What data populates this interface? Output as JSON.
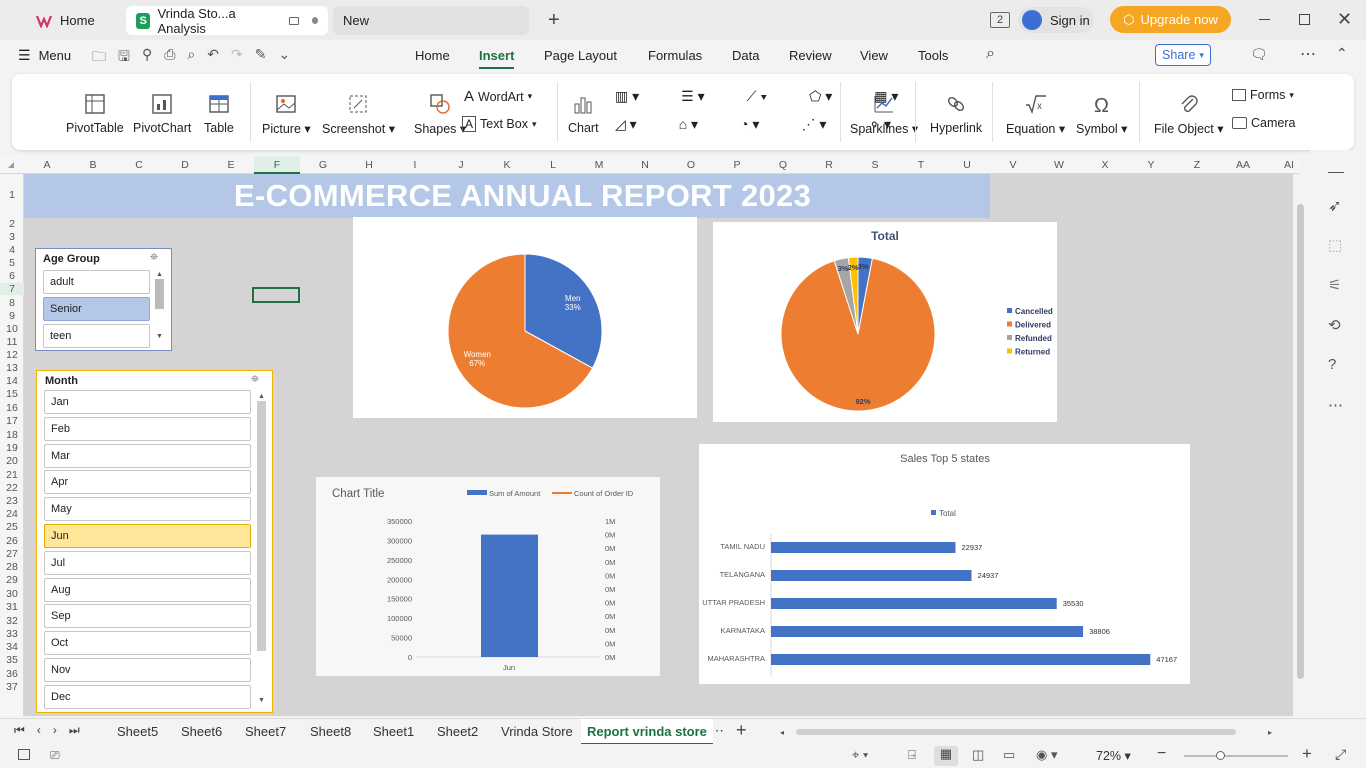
{
  "window": {
    "tabs": [
      {
        "label": "Home"
      },
      {
        "label": "Vrinda Sto...a Analysis"
      },
      {
        "label": "New"
      }
    ],
    "sign_in": "Sign in",
    "upgrade": "Upgrade now",
    "badge": "2"
  },
  "menu": {
    "menu_label": "Menu",
    "items": [
      "Home",
      "Insert",
      "Page Layout",
      "Formulas",
      "Data",
      "Review",
      "View",
      "Tools"
    ],
    "active": "Insert",
    "share": "Share"
  },
  "ribbon": {
    "pivottable": "PivotTable",
    "pivotchart": "PivotChart",
    "table": "Table",
    "picture": "Picture",
    "screenshot": "Screenshot",
    "shapes": "Shapes",
    "wordart": "WordArt",
    "textbox": "Text Box",
    "chart": "Chart",
    "sparklines": "Sparklines",
    "hyperlink": "Hyperlink",
    "equation": "Equation",
    "symbol": "Symbol",
    "fileobject": "File Object",
    "forms": "Forms",
    "camera": "Camera"
  },
  "grid": {
    "columns": [
      "A",
      "B",
      "C",
      "D",
      "E",
      "F",
      "G",
      "H",
      "I",
      "J",
      "K",
      "L",
      "M",
      "N",
      "O",
      "P",
      "Q",
      "R",
      "S",
      "T",
      "U",
      "V",
      "W",
      "X",
      "Y",
      "Z",
      "AA",
      "AI"
    ],
    "rows": [
      "1",
      "2",
      "3",
      "4",
      "5",
      "6",
      "7",
      "8",
      "9",
      "10",
      "11",
      "12",
      "13",
      "14",
      "15",
      "16",
      "17",
      "18",
      "19",
      "20",
      "21",
      "22",
      "23",
      "24",
      "25",
      "26",
      "27",
      "28",
      "29",
      "30",
      "31",
      "32",
      "33",
      "34",
      "35",
      "36",
      "37"
    ]
  },
  "report": {
    "title": "E-COMMERCE ANNUAL REPORT 2023"
  },
  "age_slicer": {
    "title": "Age Group",
    "items": [
      "adult",
      "Senior",
      "teen"
    ],
    "selected": "Senior"
  },
  "month_slicer": {
    "title": "Month",
    "items": [
      "Jan",
      "Feb",
      "Mar",
      "Apr",
      "May",
      "Jun",
      "Jul",
      "Aug",
      "Sep",
      "Oct",
      "Nov",
      "Dec"
    ],
    "selected": "Jun"
  },
  "chart_data": [
    {
      "type": "pie",
      "title": "",
      "labels": [
        "Men",
        "Women"
      ],
      "values": [
        33,
        67
      ],
      "data_labels": [
        "33%",
        "67%"
      ],
      "colors": [
        "#4472c4",
        "#ed7d31"
      ]
    },
    {
      "type": "pie",
      "title": "Total",
      "labels": [
        "Cancelled",
        "Delivered",
        "Refunded",
        "Returned"
      ],
      "values": [
        3,
        92,
        3,
        2
      ],
      "data_labels": [
        "3%",
        "92%",
        "3%",
        "2%"
      ],
      "colors": [
        "#4472c4",
        "#ed7d31",
        "#a5a5a5",
        "#ffc000"
      ],
      "legend": "right"
    },
    {
      "type": "bar",
      "title": "Chart Title",
      "categories": [
        "Jun"
      ],
      "series": [
        {
          "name": "Sum of Amount",
          "values": [
            315000
          ],
          "color": "#4472c4"
        },
        {
          "name": "Count of Order ID",
          "values": [
            0
          ],
          "color": "#ed7d31"
        }
      ],
      "y_ticks": [
        "350000",
        "300000",
        "250000",
        "200000",
        "150000",
        "100000",
        "50000",
        "0"
      ],
      "y2_ticks": [
        "1M",
        "0M",
        "0M",
        "0M",
        "0M",
        "0M",
        "0M",
        "0M",
        "0M",
        "0M",
        "0M"
      ],
      "ylim": [
        0,
        350000
      ],
      "legend": "top"
    },
    {
      "type": "bar",
      "orientation": "horizontal",
      "title": "Sales Top 5 states",
      "categories": [
        "TAMIL NADU",
        "TELANGANA",
        "UTTAR PRADESH",
        "KARNATAKA",
        "MAHARASHTRA"
      ],
      "series": [
        {
          "name": "Total",
          "values": [
            22937,
            24937,
            35530,
            38806,
            47167
          ],
          "color": "#4472c4"
        }
      ],
      "value_labels": [
        "22937",
        "24937",
        "35530",
        "38806",
        "47167"
      ],
      "xlim": [
        0,
        48000
      ],
      "legend": "top"
    }
  ],
  "sheets": {
    "tabs": [
      "Sheet5",
      "Sheet6",
      "Sheet7",
      "Sheet8",
      "Sheet1",
      "Sheet2",
      "Vrinda Store",
      "Report vrinda store"
    ],
    "active": "Report vrinda store"
  },
  "status": {
    "zoom": "72%"
  },
  "colors": {
    "accent_green": "#1e7145",
    "upgrade": "#f5a623",
    "title_band": "#b4c7e7",
    "blue": "#4472c4",
    "orange": "#ed7d31"
  }
}
